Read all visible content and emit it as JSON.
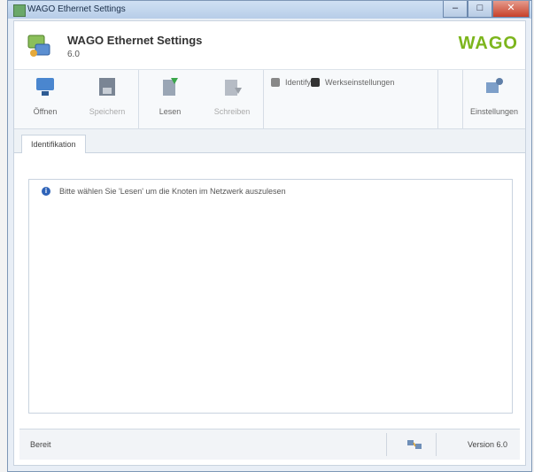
{
  "window": {
    "title": "WAGO Ethernet Settings",
    "buttons": {
      "minimize": "–",
      "maximize": "□",
      "close": "✕"
    }
  },
  "header": {
    "product_name": "WAGO Ethernet Settings",
    "product_sub": "6.0",
    "brand": "WAGO"
  },
  "ribbon": {
    "buttons": [
      {
        "label": "Öffnen",
        "icon": "network-connect-icon",
        "enabled": true
      },
      {
        "label": "Speichern",
        "icon": "save-icon",
        "enabled": false
      },
      {
        "label": "Lesen",
        "icon": "read-icon",
        "enabled": true
      },
      {
        "label": "Schreiben",
        "icon": "write-icon",
        "enabled": false
      }
    ],
    "list_items": [
      {
        "label": "Identify",
        "icon": "identify-icon"
      },
      {
        "label": "Werkseinstellungen",
        "icon": "factory-icon"
      }
    ],
    "settings_label": "Einstellungen"
  },
  "tabs": [
    {
      "label": "Identifikation"
    }
  ],
  "message": "Bitte wählen Sie 'Lesen' um die Knoten im Netzwerk auszulesen",
  "status": {
    "left": "Bereit",
    "version": "Version 6.0"
  },
  "colors": {
    "brand_green": "#7cb51c",
    "info_blue": "#2e63b8",
    "close_red": "#c7402a"
  }
}
